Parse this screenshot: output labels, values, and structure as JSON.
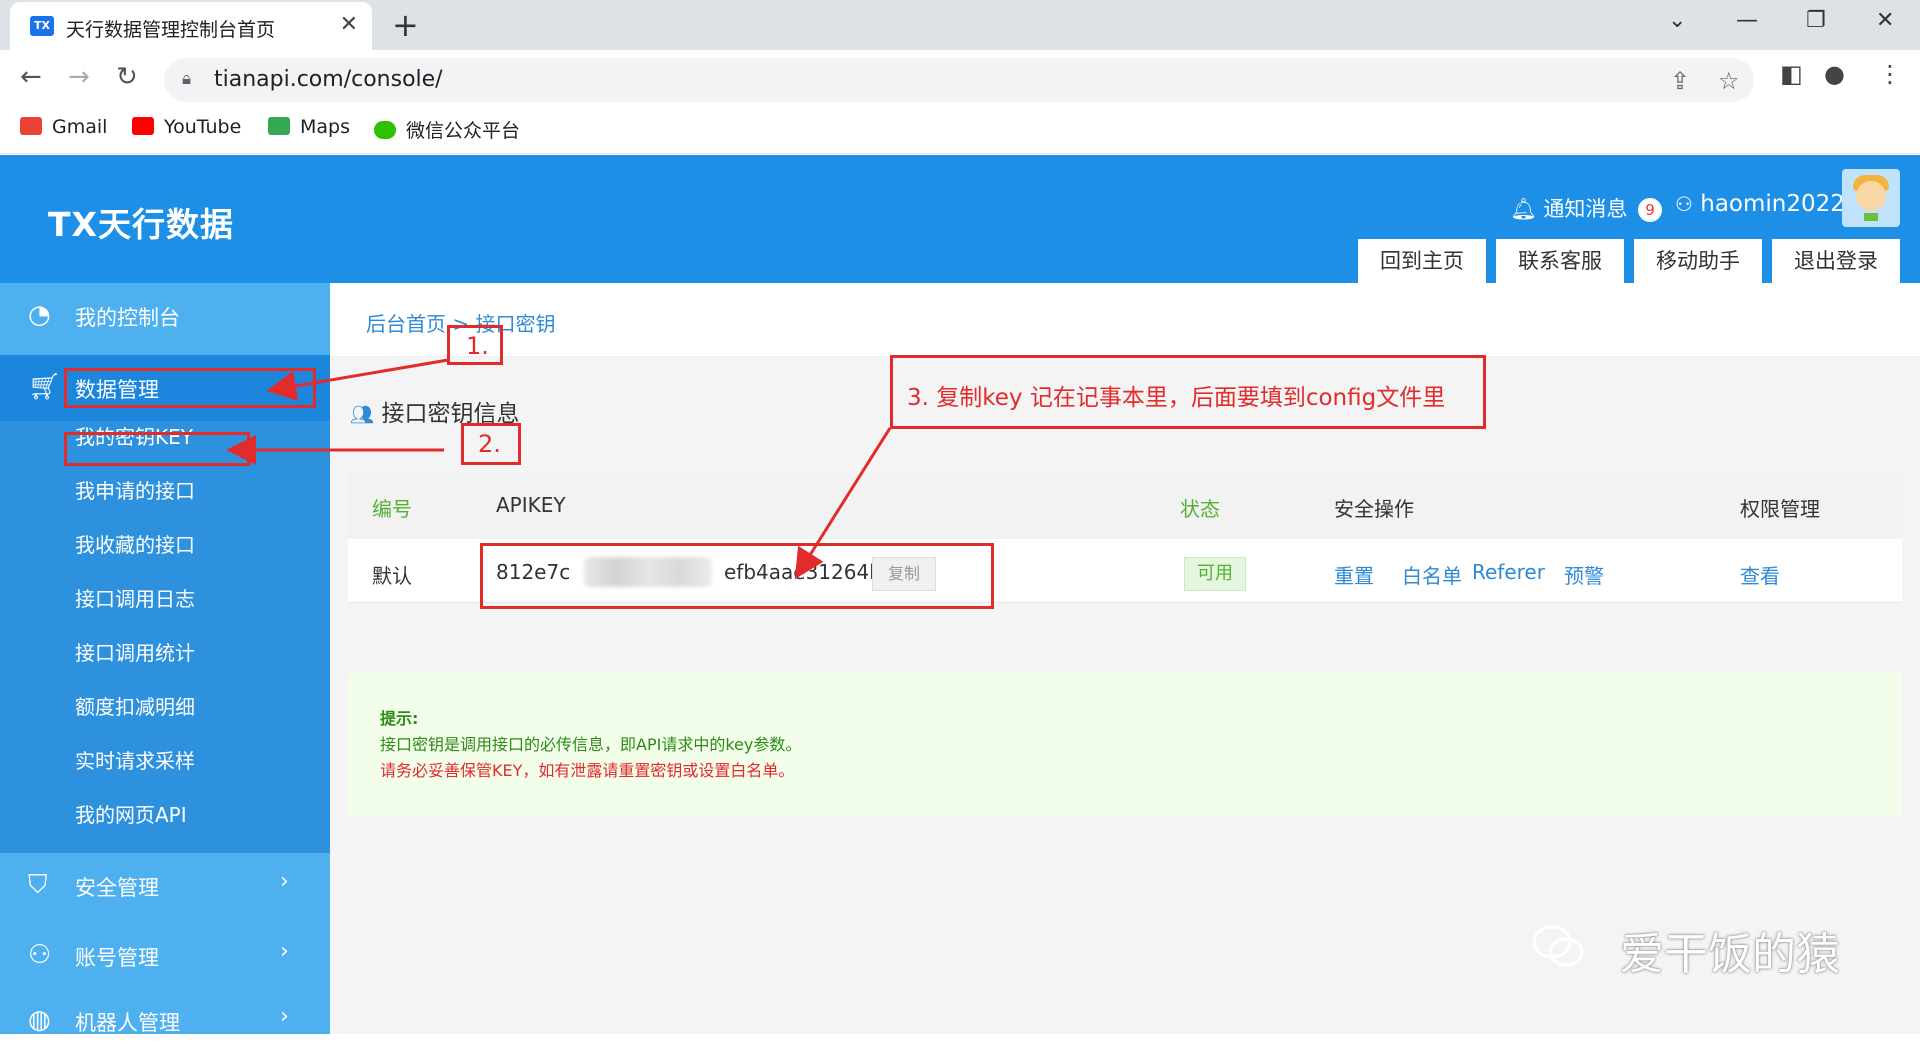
{
  "browser": {
    "tab_title": "天行数据管理控制台首页",
    "favicon_text": "TX",
    "url": "tianapi.com/console/",
    "bookmarks": [
      "Gmail",
      "YouTube",
      "Maps",
      "微信公众平台"
    ]
  },
  "header": {
    "logo": "TX天行数据",
    "notify_label": "通知消息",
    "notify_count": "9",
    "username": "haomin2022",
    "buttons": [
      "回到主页",
      "联系客服",
      "移动助手",
      "退出登录"
    ]
  },
  "sidebar": {
    "items": [
      {
        "label": "我的控制台",
        "icon": "dashboard-icon"
      },
      {
        "label": "数据管理",
        "icon": "cart-icon"
      },
      {
        "label": "安全管理",
        "icon": "shield-icon"
      },
      {
        "label": "账号管理",
        "icon": "user-icon"
      },
      {
        "label": "机器人管理",
        "icon": "robot-icon"
      }
    ],
    "submenu": [
      "我的密钥KEY",
      "我申请的接口",
      "我收藏的接口",
      "接口调用日志",
      "接口调用统计",
      "额度扣减明细",
      "实时请求采样",
      "我的网页API"
    ]
  },
  "content": {
    "breadcrumb": "后台首页 > 接口密钥",
    "card_title": "接口密钥信息",
    "table": {
      "headers": [
        "编号",
        "APIKEY",
        "状态",
        "安全操作",
        "权限管理"
      ],
      "row": {
        "id": "默认",
        "key_prefix": "812e7c",
        "key_suffix": "efb4aae31264b",
        "copy": "复制",
        "status": "可用",
        "actions": [
          "重置",
          "白名单",
          "Referer",
          "预警"
        ],
        "perm": "查看"
      }
    },
    "tips": {
      "title": "提示:",
      "line1": "接口密钥是调用接口的必传信息，即API请求中的key参数。",
      "line2": "请务必妥善保管KEY，如有泄露请重置密钥或设置白名单。"
    }
  },
  "annotations": {
    "step1": "1.",
    "step2": "2.",
    "step3": "3. 复制key 记在记事本里，后面要填到config文件里",
    "color": "#e22b2b"
  },
  "watermark": "爱干饭的猿",
  "colors": {
    "brand": "#1e8fe6",
    "sidebar": "#4fb0ef",
    "link": "#2f8ad6",
    "ok": "#56b035",
    "danger": "#e22b2b"
  }
}
